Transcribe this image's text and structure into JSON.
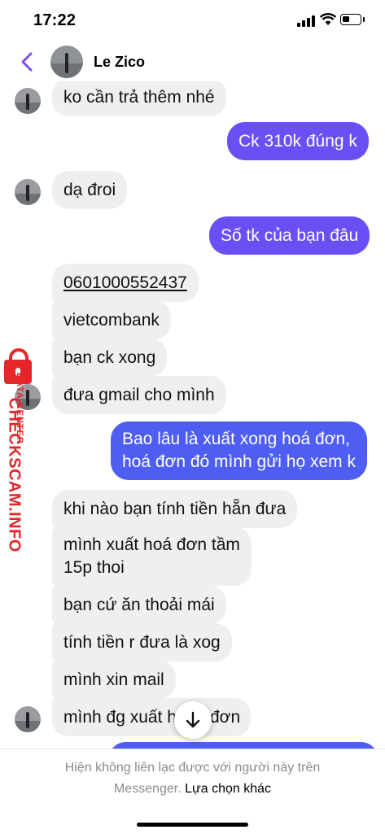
{
  "status_bar": {
    "time": "17:22"
  },
  "header": {
    "contact_name": "Le Zico"
  },
  "messages": [
    {
      "direction": "in",
      "text": "ko cần trả thêm nhé"
    },
    {
      "direction": "out",
      "text": "Ck 310k đúng k"
    },
    {
      "direction": "in",
      "text": "dạ đroi"
    },
    {
      "direction": "out",
      "text": "Số tk của bạn đâu"
    },
    {
      "direction": "in",
      "text": "0601000552437"
    },
    {
      "direction": "in",
      "text": "vietcombank"
    },
    {
      "direction": "in",
      "text": "bạn ck xong"
    },
    {
      "direction": "in",
      "text": "đưa gmail cho mình"
    },
    {
      "direction": "out",
      "text_line1": "Bao lâu là xuất xong hoá đơn,",
      "text_line2": "hoá đơn đó mình gửi họ xem k"
    },
    {
      "direction": "in",
      "text": "khi nào bạn tính tiền hẵn đưa"
    },
    {
      "direction": "in",
      "text_line1": "mình xuất hoá đơn tầm",
      "text_line2": "15p thoi"
    },
    {
      "direction": "in",
      "text": "bạn cứ ăn thoải mái"
    },
    {
      "direction": "in",
      "text": "tính tiền r đưa là xog"
    },
    {
      "direction": "in",
      "text": "mình xin mail"
    },
    {
      "direction": "in",
      "text_left": "mình đg xuất h",
      "text_right": "đơn"
    }
  ],
  "footer": {
    "notice": "Hiện không liên lạc được với người này trên",
    "notice_line2": "Messenger.",
    "other_options": "Lựa chọn khác"
  },
  "watermark": {
    "brand": "CHECKSCAM.INFO",
    "sub": "DATA CENTER"
  },
  "colors": {
    "outgoing_bubble": "#6a4ff5",
    "outgoing_bubble_blue": "#4e5ef2",
    "incoming_bubble": "#efefef",
    "accent": "#7b4dff",
    "watermark": "#e5262a"
  },
  "icons": {
    "back": "chevron-left-icon",
    "scroll_down": "arrow-down-icon"
  }
}
